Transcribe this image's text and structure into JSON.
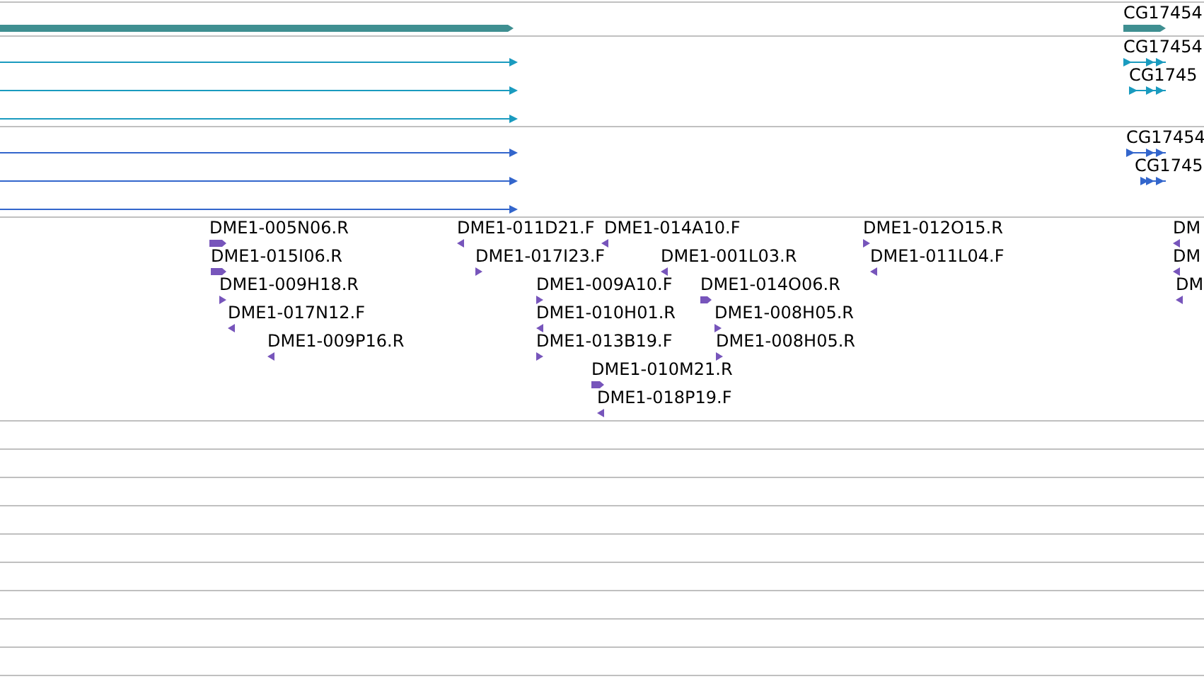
{
  "tracks": [
    {
      "color": "#3f8f91",
      "features": [
        {
          "kind": "bar",
          "reverse": false
        },
        {
          "kind": "bar",
          "reverse": false,
          "label": "CG17454"
        }
      ]
    },
    {
      "color": "#1a9bbf",
      "features": [
        {
          "kind": "line",
          "reverse": false
        },
        {
          "kind": "line",
          "reverse": false
        },
        {
          "kind": "line",
          "reverse": false
        },
        {
          "kind": "exons",
          "reverse": false,
          "label": "CG17454"
        },
        {
          "kind": "exons",
          "reverse": false,
          "label": "CG1745"
        }
      ]
    },
    {
      "color": "#3366cc",
      "features": [
        {
          "kind": "line",
          "reverse": false
        },
        {
          "kind": "line",
          "reverse": false
        },
        {
          "kind": "line",
          "reverse": false
        },
        {
          "kind": "exons",
          "reverse": false,
          "label": "CG17454"
        },
        {
          "kind": "exons",
          "reverse": false,
          "label": "CG1745"
        }
      ]
    },
    {
      "color": "#7755bb",
      "features": [
        {
          "kind": "est",
          "reverse": false,
          "label": "DME1-005N06.R"
        },
        {
          "kind": "est",
          "reverse": true,
          "label": "DME1-011D21.F"
        },
        {
          "kind": "est",
          "reverse": true,
          "label": "DME1-014A10.F"
        },
        {
          "kind": "est",
          "reverse": false,
          "label": "DME1-012O15.R"
        },
        {
          "kind": "est",
          "reverse": true,
          "label": "DM"
        },
        {
          "kind": "est",
          "reverse": false,
          "label": "DME1-015I06.R"
        },
        {
          "kind": "est",
          "reverse": false,
          "label": "DME1-017I23.F"
        },
        {
          "kind": "est",
          "reverse": true,
          "label": "DME1-001L03.R"
        },
        {
          "kind": "est",
          "reverse": true,
          "label": "DME1-011L04.F"
        },
        {
          "kind": "est",
          "reverse": true,
          "label": "DM"
        },
        {
          "kind": "est",
          "reverse": false,
          "label": "DME1-009H18.R"
        },
        {
          "kind": "est",
          "reverse": false,
          "label": "DME1-009A10.F"
        },
        {
          "kind": "est",
          "reverse": false,
          "label": "DME1-014O06.R"
        },
        {
          "kind": "est",
          "reverse": true,
          "label": "DM"
        },
        {
          "kind": "est",
          "reverse": true,
          "label": "DME1-017N12.F"
        },
        {
          "kind": "est",
          "reverse": true,
          "label": "DME1-010H01.R"
        },
        {
          "kind": "est",
          "reverse": false,
          "label": "DME1-008H05.R"
        },
        {
          "kind": "est",
          "reverse": true,
          "label": "DME1-009P16.R"
        },
        {
          "kind": "est",
          "reverse": false,
          "label": "DME1-013B19.F"
        },
        {
          "kind": "est",
          "reverse": false,
          "label": "DME1-008H05.R"
        },
        {
          "kind": "est",
          "reverse": false,
          "label": "DME1-010M21.R"
        },
        {
          "kind": "est",
          "reverse": true,
          "label": "DME1-018P19.F"
        }
      ]
    }
  ]
}
